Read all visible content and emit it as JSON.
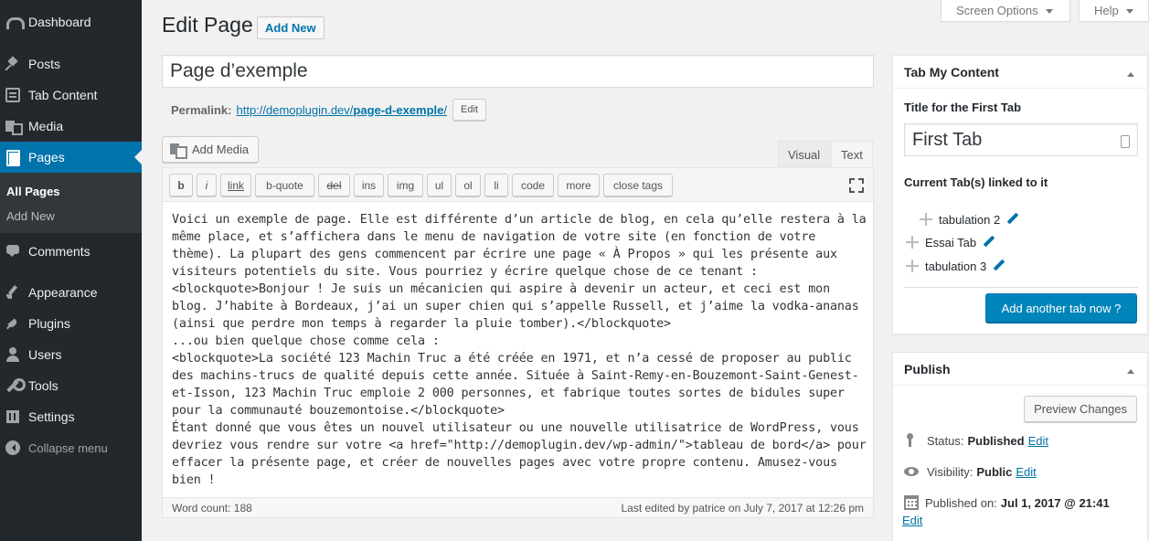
{
  "sidebar": {
    "items": [
      {
        "label": "Dashboard",
        "icon": "dashboard-icon"
      },
      {
        "label": "Posts",
        "icon": "pin-icon"
      },
      {
        "label": "Tab Content",
        "icon": "tab-content-icon"
      },
      {
        "label": "Media",
        "icon": "media-icon"
      },
      {
        "label": "Pages",
        "icon": "pages-icon"
      },
      {
        "label": "Comments",
        "icon": "comments-icon"
      },
      {
        "label": "Appearance",
        "icon": "brush-icon"
      },
      {
        "label": "Plugins",
        "icon": "plugin-icon"
      },
      {
        "label": "Users",
        "icon": "users-icon"
      },
      {
        "label": "Tools",
        "icon": "tools-icon"
      },
      {
        "label": "Settings",
        "icon": "settings-icon"
      }
    ],
    "submenu": [
      {
        "label": "All Pages"
      },
      {
        "label": "Add New"
      }
    ],
    "collapse_label": "Collapse menu"
  },
  "screen_meta": {
    "screen_options": "Screen Options",
    "help": "Help"
  },
  "header": {
    "title": "Edit Page",
    "add_new": "Add New"
  },
  "post": {
    "title": "Page d’exemple",
    "permalink_label": "Permalink:",
    "permalink_base": "http://demoplugin.dev/",
    "permalink_slug": "page-d-exemple",
    "permalink_trailing": "/",
    "permalink_edit": "Edit"
  },
  "editor": {
    "add_media": "Add Media",
    "tabs": [
      "Visual",
      "Text"
    ],
    "active_tab": "Text",
    "quicktags": [
      "b",
      "i",
      "link",
      "b-quote",
      "del",
      "ins",
      "img",
      "ul",
      "ol",
      "li",
      "code",
      "more",
      "close tags"
    ],
    "content": "Voici un exemple de page. Elle est différente d’un article de blog, en cela qu’elle restera à la même place, et s’affichera dans le menu de navigation de votre site (en fonction de votre thème). La plupart des gens commencent par écrire une page « À Propos » qui les présente aux visiteurs potentiels du site. Vous pourriez y écrire quelque chose de ce tenant :\n<blockquote>Bonjour ! Je suis un mécanicien qui aspire à devenir un acteur, et ceci est mon blog. J’habite à Bordeaux, j’ai un super chien qui s’appelle Russell, et j’aime la vodka-ananas (ainsi que perdre mon temps à regarder la pluie tomber).</blockquote>\n...ou bien quelque chose comme cela :\n<blockquote>La société 123 Machin Truc a été créée en 1971, et n’a cessé de proposer au public des machins-trucs de qualité depuis cette année. Située à Saint-Remy-en-Bouzemont-Saint-Genest-et-Isson, 123 Machin Truc emploie 2 000 personnes, et fabrique toutes sortes de bidules super pour la communauté bouzemontoise.</blockquote>\nÉtant donné que vous êtes un nouvel utilisateur ou une nouvelle utilisatrice de WordPress, vous devriez vous rendre sur votre <a href=\"http://demoplugin.dev/wp-admin/\">tableau de bord</a> pour effacer la présente page, et créer de nouvelles pages avec votre propre contenu. Amusez-vous bien !",
    "word_count": "Word count: 188",
    "last_edited": "Last edited by patrice on July 7, 2017 at 12:26 pm"
  },
  "tab_box": {
    "title": "Tab My Content",
    "first_tab_label": "Title for the First Tab",
    "first_tab_value": "First Tab",
    "linked_label": "Current Tab(s) linked to it",
    "linked_tabs": [
      "tabulation 2",
      "Essai Tab",
      "tabulation 3"
    ],
    "add_button": "Add another tab now ?"
  },
  "publish_box": {
    "title": "Publish",
    "preview": "Preview Changes",
    "status_label": "Status:",
    "status_value": "Published",
    "visibility_label": "Visibility:",
    "visibility_value": "Public",
    "published_label": "Published on:",
    "published_value": "Jul 1, 2017 @ 21:41",
    "edit": "Edit"
  },
  "colors": {
    "sidebar_bg": "#23282d",
    "accent": "#0073aa",
    "primary_button": "#0085ba"
  }
}
